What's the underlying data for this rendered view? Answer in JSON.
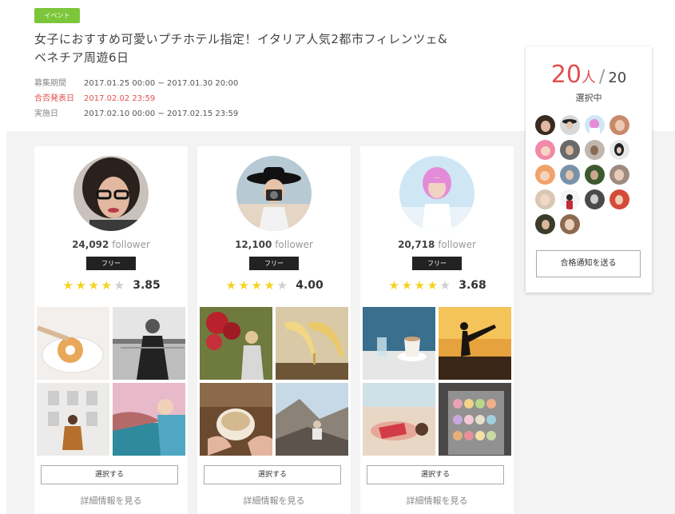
{
  "event": {
    "badge": "イベント",
    "title_line1": "女子におすすめ可愛いプチホテル指定！イタリア人気2都市フィレンツェ&",
    "title_line2": "ベネチア周遊6日",
    "meta": [
      {
        "label": "募集期間",
        "value": "2017.01.25  00:00 ~ 2017.01.30  20:00"
      },
      {
        "label": "合否発表日",
        "value": "2017.02.02  23:59"
      },
      {
        "label": "実施日",
        "value": "2017.02.10  00:00 ~ 2017.02.15  23:59"
      }
    ]
  },
  "cards": [
    {
      "followers": "24,092",
      "follower_word": "follower",
      "tag": "フリー",
      "stars": 4,
      "score": "3.85",
      "select_label": "選択する",
      "detail_label": "詳細情報を見る"
    },
    {
      "followers": "12,100",
      "follower_word": "follower",
      "tag": "フリー",
      "stars": 4,
      "score": "4.00",
      "select_label": "選択する",
      "detail_label": "詳細情報を見る"
    },
    {
      "followers": "20,718",
      "follower_word": "follower",
      "tag": "フリー",
      "stars": 4,
      "score": "3.68",
      "select_label": "選択する",
      "detail_label": "詳細情報を見る"
    }
  ],
  "panel": {
    "selected_count": "20",
    "unit": "人",
    "total": "20",
    "selecting_label": "選択中",
    "notify_button": "合格通知を送る"
  },
  "colors": {
    "accent_red": "#e05050",
    "badge_green": "#7dc63b",
    "star_yellow": "#f4d31f"
  }
}
